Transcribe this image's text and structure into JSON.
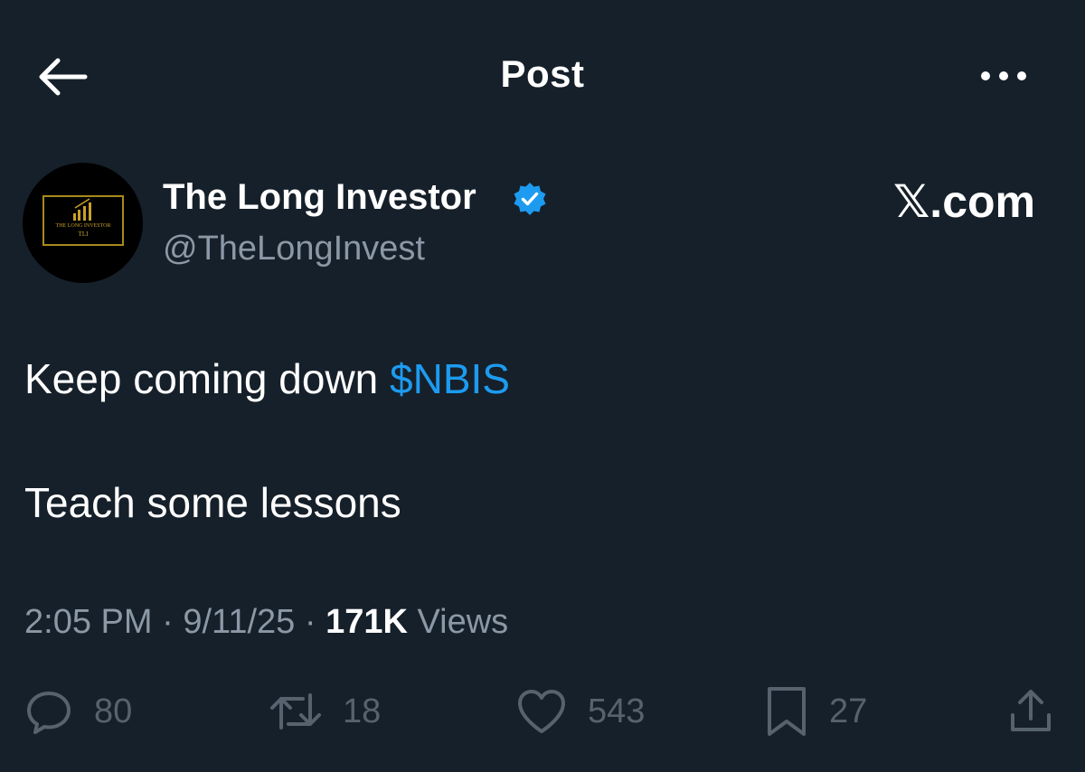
{
  "header": {
    "title": "Post",
    "back_icon": "arrow-left-icon",
    "more_icon": "more-horizontal-icon"
  },
  "author": {
    "display_name": "The Long Investor",
    "handle": "@TheLongInvest",
    "verified": true,
    "avatar_text_top": "THE LONG INVESTOR",
    "avatar_text_bottom": "TLI"
  },
  "watermark": "𝕏.com",
  "tweet": {
    "line1_text": "Keep coming down ",
    "cashtag": "$NBIS",
    "line2_text": "Teach some lessons"
  },
  "meta": {
    "time": "2:05 PM",
    "separator": " · ",
    "date": "9/11/25",
    "separator2": " · ",
    "views_count": "171K",
    "views_label": " Views"
  },
  "actions": {
    "replies": "80",
    "reposts": "18",
    "likes": "543",
    "bookmarks": "27"
  },
  "colors": {
    "background": "#16202a",
    "accent": "#1d9bf0",
    "secondary_text": "#8b98a5"
  }
}
